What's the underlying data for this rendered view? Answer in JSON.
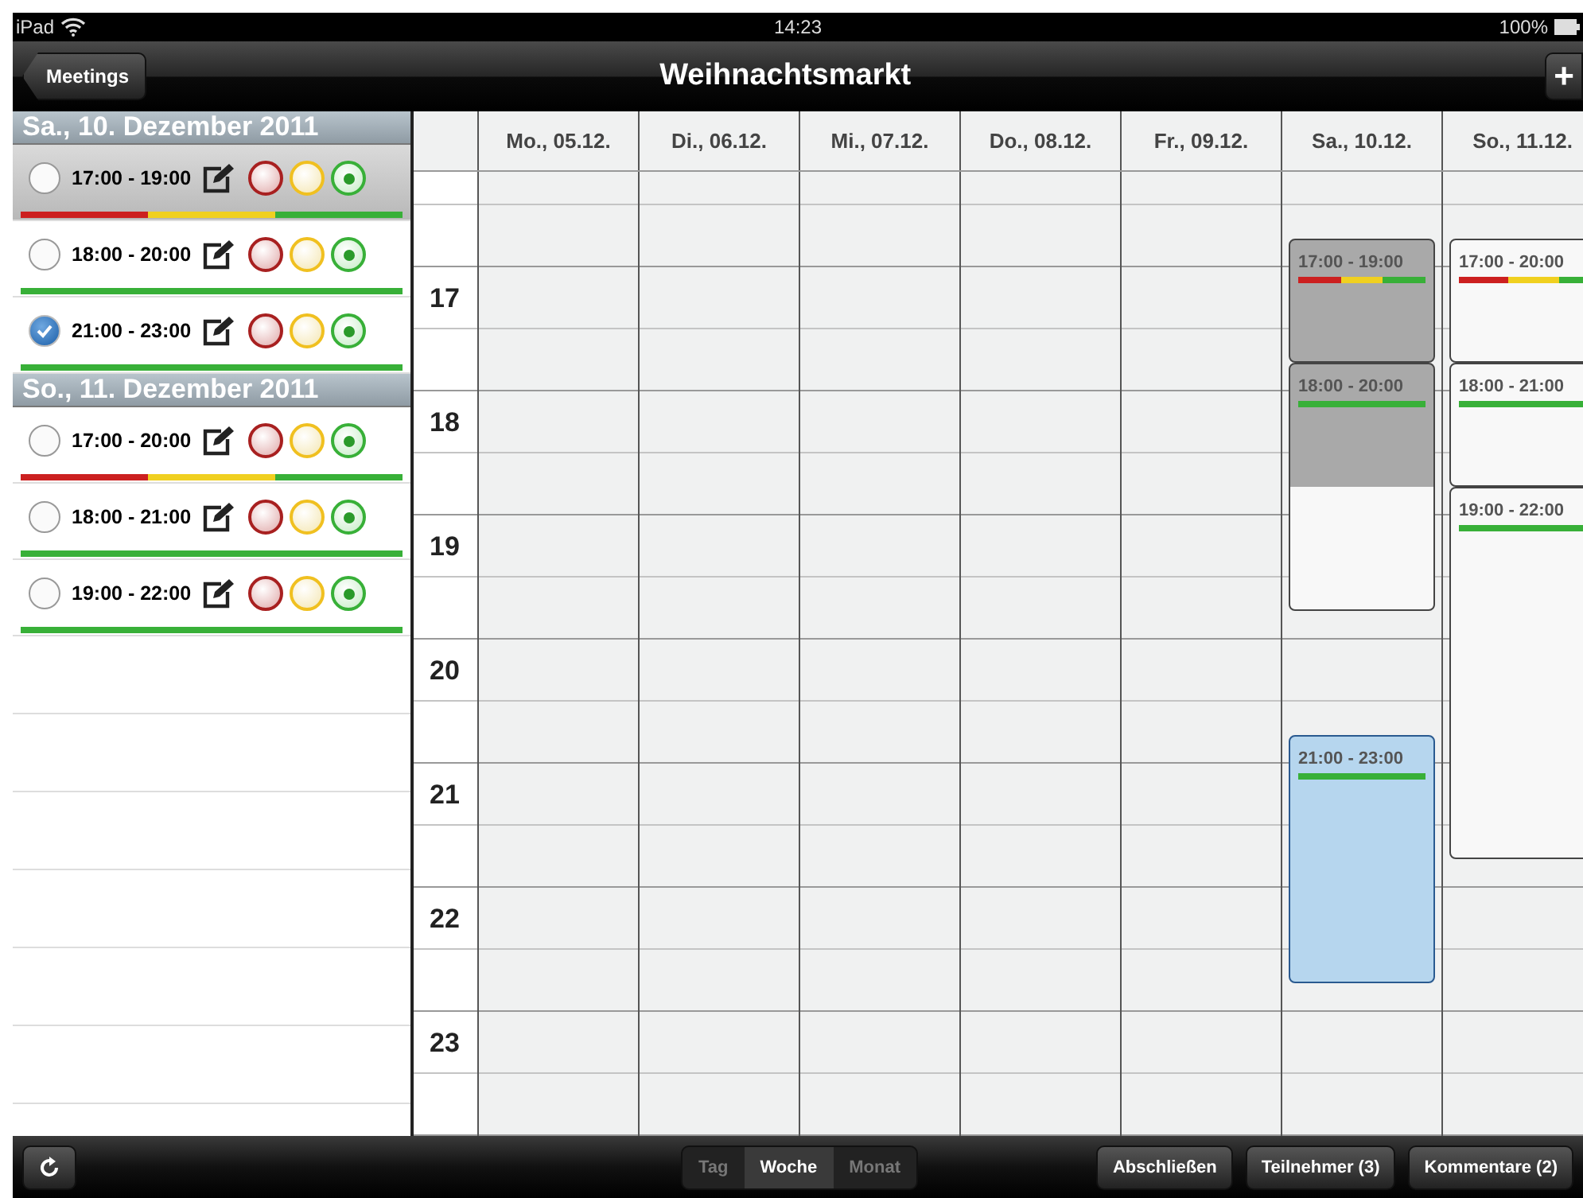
{
  "status_bar": {
    "device": "iPad",
    "time": "14:23",
    "battery": "100%"
  },
  "nav_bar": {
    "back": "Meetings",
    "title": "Weihnachtsmarkt",
    "add": "+"
  },
  "sidebar": {
    "sections": [
      {
        "heading": "Sa., 10. Dezember 2011",
        "items": [
          {
            "time": "17:00 - 19:00",
            "checked": false,
            "selected": true,
            "votes": [
              {
                "color": "#cc2020"
              },
              {
                "color": "#f0d020"
              },
              {
                "color": "#38b038"
              }
            ]
          },
          {
            "time": "18:00 - 20:00",
            "checked": false,
            "selected": false,
            "votes": [
              {
                "color": "#38b038"
              },
              {
                "color": "#38b038"
              },
              {
                "color": "#38b038"
              }
            ]
          },
          {
            "time": "21:00 - 23:00",
            "checked": true,
            "selected": false,
            "votes": [
              {
                "color": "#38b038"
              },
              {
                "color": "#38b038"
              },
              {
                "color": "#38b038"
              }
            ]
          }
        ]
      },
      {
        "heading": "So., 11. Dezember 2011",
        "items": [
          {
            "time": "17:00 - 20:00",
            "checked": false,
            "selected": false,
            "votes": [
              {
                "color": "#cc2020"
              },
              {
                "color": "#f0d020"
              },
              {
                "color": "#38b038"
              }
            ]
          },
          {
            "time": "18:00 - 21:00",
            "checked": false,
            "selected": false,
            "votes": [
              {
                "color": "#38b038"
              },
              {
                "color": "#38b038"
              },
              {
                "color": "#38b038"
              }
            ]
          },
          {
            "time": "19:00 - 22:00",
            "checked": false,
            "selected": false,
            "votes": [
              {
                "color": "#38b038"
              },
              {
                "color": "#38b038"
              },
              {
                "color": "#38b038"
              }
            ]
          }
        ]
      }
    ]
  },
  "week": {
    "hours": [
      "17",
      "18",
      "19",
      "20",
      "21",
      "22",
      "23"
    ],
    "days": [
      {
        "label": "Mo., 05.12."
      },
      {
        "label": "Di., 06.12."
      },
      {
        "label": "Mi., 07.12."
      },
      {
        "label": "Do., 08.12."
      },
      {
        "label": "Fr., 09.12."
      },
      {
        "label": "Sa., 10.12.",
        "events": [
          {
            "label": "17:00 - 19:00",
            "selected": true,
            "checked": false,
            "votes": [
              {
                "color": "#cc2020"
              },
              {
                "color": "#f0d020"
              },
              {
                "color": "#38b038"
              }
            ]
          },
          {
            "label": "18:00 - 20:00",
            "selected": false,
            "checked": false,
            "votes": [
              {
                "color": "#38b038"
              },
              {
                "color": "#38b038"
              },
              {
                "color": "#38b038"
              }
            ]
          },
          {
            "label": "21:00 - 23:00",
            "selected": false,
            "checked": true,
            "votes": [
              {
                "color": "#38b038"
              },
              {
                "color": "#38b038"
              },
              {
                "color": "#38b038"
              }
            ]
          }
        ]
      },
      {
        "label": "So., 11.12.",
        "events": [
          {
            "label": "17:00 - 20:00",
            "selected": false,
            "checked": false,
            "votes": [
              {
                "color": "#cc2020"
              },
              {
                "color": "#f0d020"
              },
              {
                "color": "#38b038"
              }
            ]
          },
          {
            "label": "18:00 - 21:00",
            "selected": false,
            "checked": false,
            "votes": [
              {
                "color": "#38b038"
              },
              {
                "color": "#38b038"
              },
              {
                "color": "#38b038"
              }
            ]
          },
          {
            "label": "19:00 - 22:00",
            "selected": false,
            "checked": false,
            "votes": [
              {
                "color": "#38b038"
              },
              {
                "color": "#38b038"
              },
              {
                "color": "#38b038"
              }
            ]
          }
        ]
      }
    ]
  },
  "toolbar": {
    "views": [
      {
        "label": "Tag",
        "selected": false
      },
      {
        "label": "Woche",
        "selected": true
      },
      {
        "label": "Monat",
        "selected": false
      }
    ],
    "buttons": [
      "Abschließen",
      "Teilnehmer (3)",
      "Kommentare (2)"
    ]
  }
}
